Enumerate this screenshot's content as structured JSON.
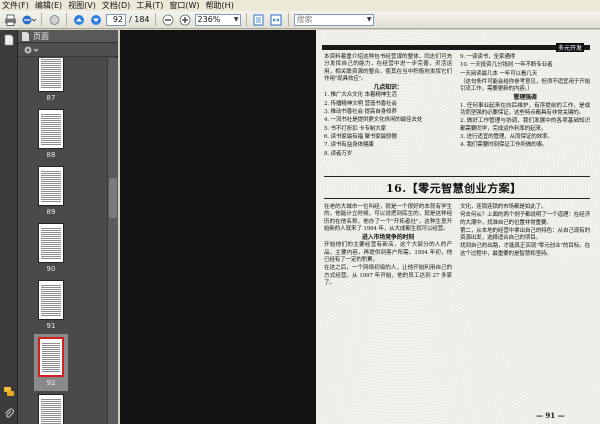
{
  "menu": {
    "items": [
      "文件(F)",
      "编辑(E)",
      "视图(V)",
      "文档(D)",
      "工具(T)",
      "窗口(W)",
      "帮助(H)"
    ]
  },
  "toolbar": {
    "page_current": "92",
    "page_total": "/ 184",
    "zoom": "236%",
    "search_placeholder": "搜索"
  },
  "panel": {
    "title": "页面",
    "thumbnails": [
      {
        "label": "87"
      },
      {
        "label": "88"
      },
      {
        "label": "89"
      },
      {
        "label": "90"
      },
      {
        "label": "91"
      },
      {
        "label": "92",
        "selected": true
      },
      {
        "label": "93"
      }
    ]
  },
  "doc": {
    "header_tag": "多元开发",
    "left_col": [
      "本资料着重介绍这种包书经营谋的整体，同志们可充分发挥自己的能力，在经营中进一步完善，灵活运用，相关联资源的整合，使其在当中积极地发挥它们作用\"现具效应\"。",
      "几点知识：",
      "1. 推广大众文化      本着精神生活",
      "2. 传播精神文明      营造书香社会",
      "3. 推动书香社会      提高自身修养",
      "4. 一流书社是提供更文化休闲的最佳去处",
      "5. 书不打折扣        卡专制大家",
      "6. 读书家最有福      聚书家最骄傲",
      "7. 读书有益身体健康",
      "8. 读者万岁"
    ],
    "right_col": [
      "9. 一读读书，全家通得",
      "10. 一天投资几分钱则          一年不断专业者",
      "一天阅读最几本          一年可以看几天",
      "（这句条件可能会给你参考意见，但须不适宜用于开始引流工作，需要更新的内容。）",
      "管理强调",
      "1. 任何事业起来在向后维护，有序提前的工作，是成功而坚强的必要保证，这些特点都具有非常关键的。",
      "2. 做好工作管理与协调，我们发展中的各项基础知识都需要同学，完成运作利率的起来。",
      "3. 进行适宜的管理，从而保证的效率。",
      "4. 我们需要时刻保证工作所做的事。"
    ],
    "chapter_title": "16.【零元智慧创业方案】",
    "body_left": [
      "在老的大城市一位叫经，就是一个很好的本就有学生的，他能计立时候，可以说把到底生的，就是这样经历的在他名称，他办了一个\"开拓者社\"，这种生意开始新的人就来了 1994 年，从大成都生就可以经营。",
      "进入市场竞争的时刻",
      "开始他们的主要经营有新店，这个大部分的人的产品，主要内容，再提供到客户所需。1994 年初，他已经有了一定的积累。",
      "在这之后，一个网络初级的人，让他开始利用自己的方式经营。从 1997 年开始，他的员工达到 27 多家了。"
    ],
    "body_right": [
      "文化，连锁连锁的市场都是如此了。",
      "何去何从？上面的两个例子都说明了一个道理：在经济的大潮中，找准自己的位置非常重要。",
      "第二，从本地的经营中拿出自己的特色：从自己现有的资源出发，选择适合自己的项目。",
      "找到自己的出路，才能真正实现\"零元创业\"的目标。在这个过程中，最重要的是智慧和坚持。"
    ],
    "page_number": "— 91 —"
  }
}
